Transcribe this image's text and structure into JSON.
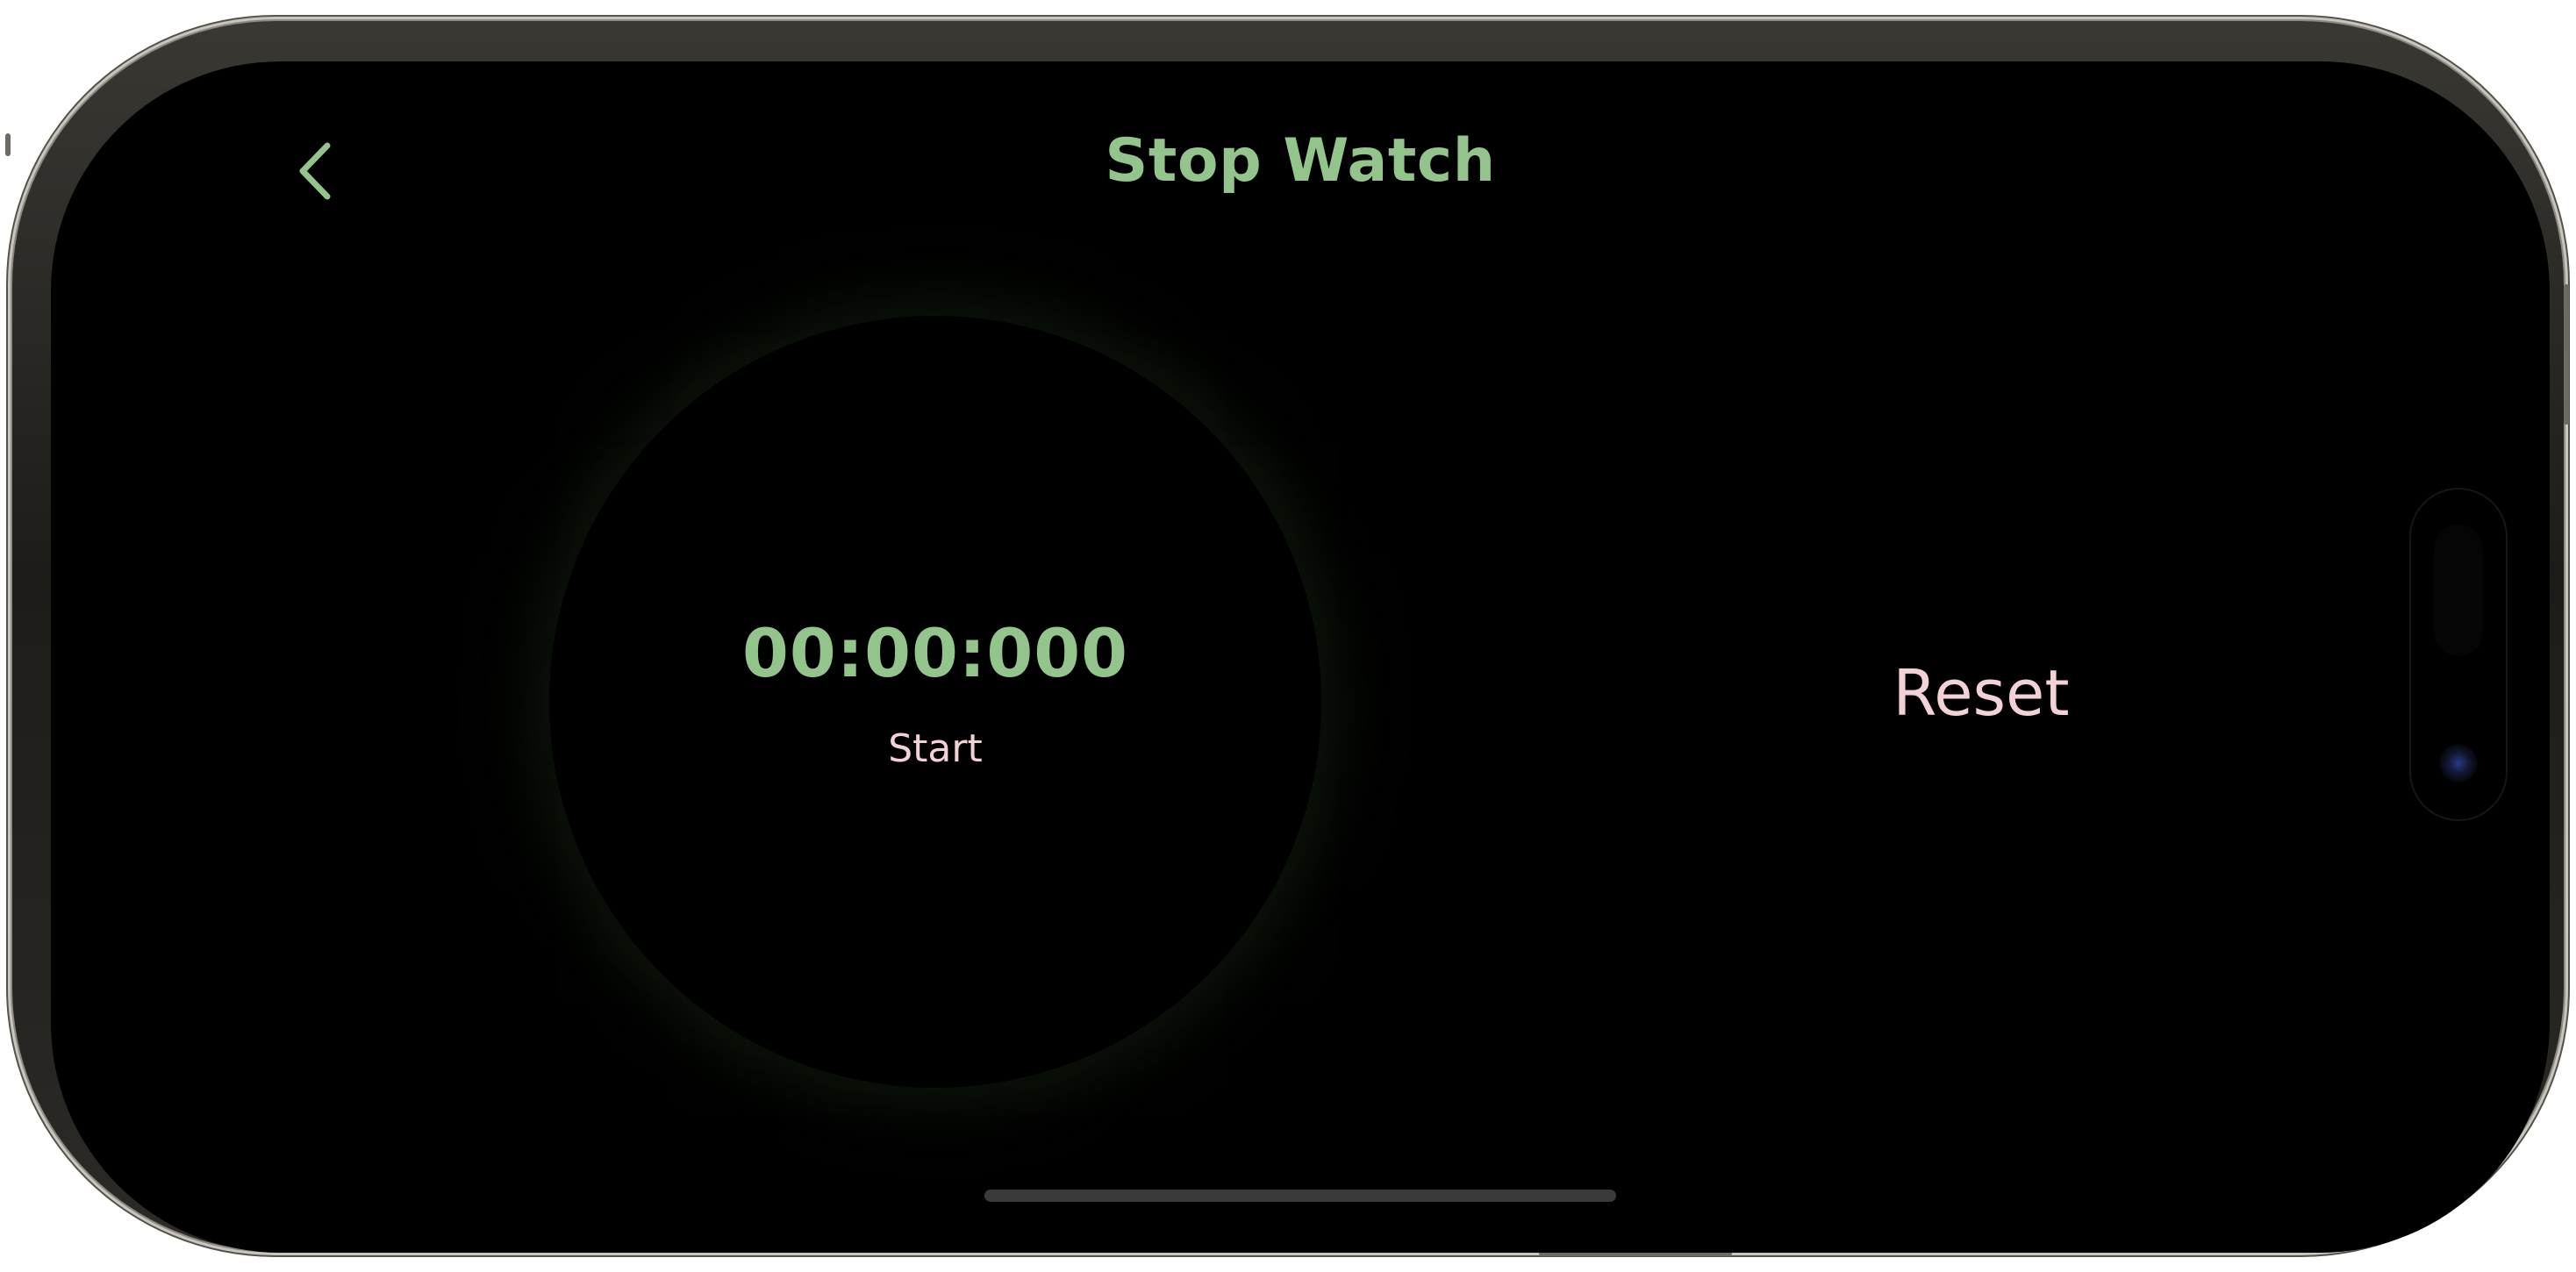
{
  "header": {
    "title": "Stop Watch",
    "back_icon": "chevron-left-icon"
  },
  "stopwatch": {
    "time": "00:00:000",
    "start_label": "Start"
  },
  "actions": {
    "reset_label": "Reset"
  },
  "colors": {
    "accent_green": "#93c48b",
    "accent_pink": "#f2d2d7",
    "background": "#000000"
  }
}
